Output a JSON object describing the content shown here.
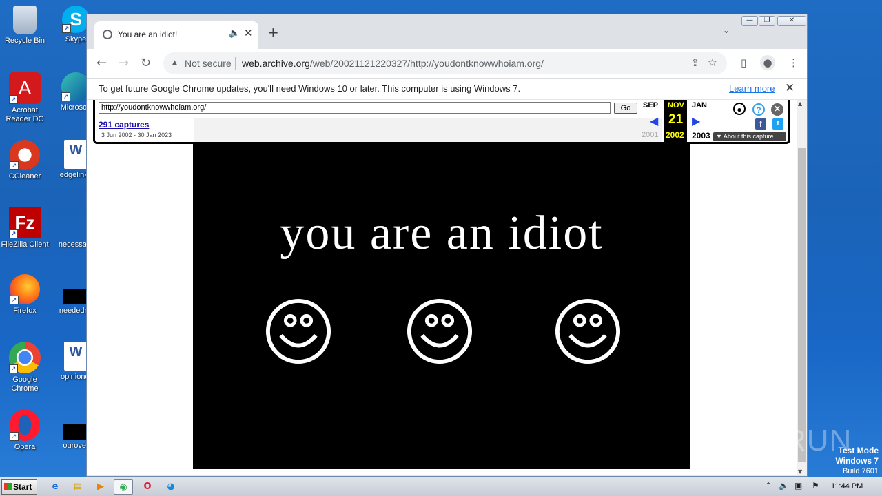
{
  "desktop": {
    "icons": [
      {
        "label": "Recycle Bin"
      },
      {
        "label": "Skype"
      },
      {
        "label": "Acrobat Reader DC"
      },
      {
        "label": "Microsoft"
      },
      {
        "label": "CCleaner"
      },
      {
        "label": "edgelinks"
      },
      {
        "label": "FileZilla Client"
      },
      {
        "label": "necessary"
      },
      {
        "label": "Firefox"
      },
      {
        "label": "neededny"
      },
      {
        "label": "Google Chrome"
      },
      {
        "label": "opinionqi"
      },
      {
        "label": "Opera"
      },
      {
        "label": "ourover"
      }
    ]
  },
  "browser": {
    "tab_title": "You are an idiot!",
    "address": {
      "not_secure": "Not secure",
      "host": "web.archive.org",
      "path": "/web/20021121220327/http://youdontknowwhoiam.org/"
    },
    "infobar": {
      "message": "To get future Google Chrome updates, you'll need Windows 10 or later. This computer is using Windows 7.",
      "link": "Learn more"
    }
  },
  "wayback": {
    "url": "http://youdontknowwhoiam.org/",
    "go": "Go",
    "captures": "291 captures",
    "range": "3 Jun 2002 - 30 Jan 2023",
    "prev_month": "SEP",
    "cur_month": "NOV",
    "next_month": "JAN",
    "day": "21",
    "prev_year": "2001",
    "cur_year": "2002",
    "next_year": "2003",
    "about": "About this capture"
  },
  "page": {
    "heading": "you are an idiot"
  },
  "watermark": {
    "brand": "ANY.RUN",
    "line1": "Test Mode",
    "line2": "Windows 7",
    "line3": "Build 7601"
  },
  "taskbar": {
    "start": "Start",
    "clock": "11:44 PM"
  }
}
